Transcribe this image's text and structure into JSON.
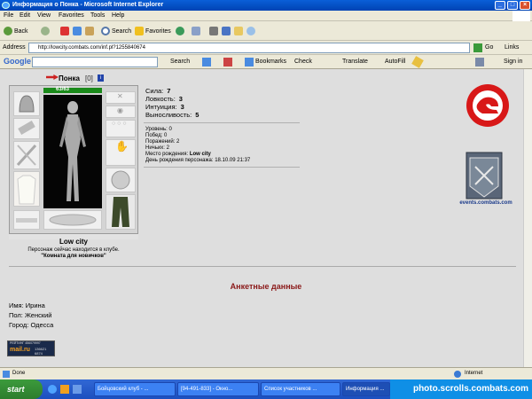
{
  "window": {
    "title": "Информация о Понка - Microsoft Internet Explorer"
  },
  "menu": [
    "File",
    "Edit",
    "View",
    "Favorites",
    "Tools",
    "Help"
  ],
  "toolbar": {
    "back": "Back",
    "search": "Search",
    "favorites": "Favorites"
  },
  "address": {
    "label": "Address",
    "url": "http://lowcity.combats.com/inf.pl?1255840674",
    "go": "Go",
    "links": "Links"
  },
  "google_bar": {
    "logo": "Google",
    "search": "Search",
    "bookmarks": "Bookmarks",
    "check": "Check",
    "translate": "Translate",
    "autofill": "AutoFill",
    "signin": "Sign in"
  },
  "character": {
    "name": "Понка",
    "level": "[0]",
    "hp": "63/63",
    "city": "Low city",
    "location_text": "Персонаж сейчас находится в клубе.",
    "room": "\"Комната для новичков\""
  },
  "stats": [
    {
      "label": "Сила:",
      "value": "7"
    },
    {
      "label": "Ловкость:",
      "value": "3"
    },
    {
      "label": "Интуиция:",
      "value": "3"
    },
    {
      "label": "Выносливость:",
      "value": "5"
    }
  ],
  "details": {
    "level": "Уровень: 0",
    "wins": "Побед: 0",
    "losses": "Поражений: 2",
    "draws": "Ничьих: 2",
    "birthplace_label": "Место рождения:",
    "birthplace_value": "Low city",
    "birthday": "День рождения персонажа: 18.10.09 21:37"
  },
  "events_link": "events.combats.com",
  "profile": {
    "heading": "Анкетные данные",
    "name": "Имя: Ирина",
    "gender": "Пол: Женский",
    "city": "Город: Одесса"
  },
  "counter": {
    "top": "РЕЙТИНГ 456079997",
    "brand": "mail.ru",
    "n1": "136621",
    "n2": "6874"
  },
  "status": {
    "left": "Done",
    "zone": "Internet"
  },
  "taskbar": {
    "start": "start",
    "tasks": [
      "Бойцовский клуб - ...",
      "[94-491-833] - Окно...",
      "Список участников ...",
      "Информация ..."
    ],
    "watermark": "photo.scrolls.combats.com"
  }
}
